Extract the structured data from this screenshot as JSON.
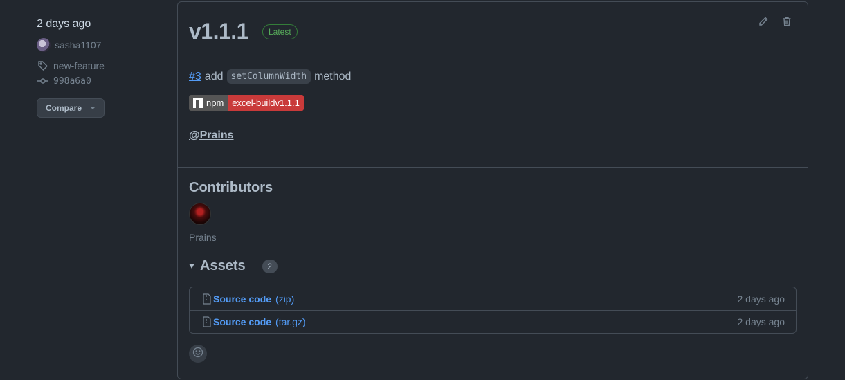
{
  "meta": {
    "date": "2 days ago",
    "author": "sasha1107",
    "tag": "new-feature",
    "commit": "998a6a0",
    "compare_label": "Compare"
  },
  "release": {
    "title": "v1.1.1",
    "latest_label": "Latest",
    "description": {
      "issue_link": "#3",
      "text_before": "add",
      "code": "setColumnWidth",
      "text_after": "method"
    },
    "npm_badge": {
      "left": "npm",
      "right": "excel-buildv1.1.1"
    },
    "mention": "@Prains"
  },
  "contributors": {
    "title": "Contributors",
    "items": [
      {
        "name": "Prains"
      }
    ]
  },
  "assets": {
    "title": "Assets",
    "count": "2",
    "items": [
      {
        "name": "Source code",
        "ext": "(zip)",
        "date": "2 days ago"
      },
      {
        "name": "Source code",
        "ext": "(tar.gz)",
        "date": "2 days ago"
      }
    ]
  },
  "icons": {
    "edit": "pencil-icon",
    "delete": "trash-icon",
    "tag": "tag-icon",
    "commit": "git-commit-icon",
    "file": "file-zip-icon",
    "reaction": "smiley-icon"
  },
  "colors": {
    "background": "#22272e",
    "link": "#539bf5",
    "latest": "#57ab5a",
    "npm_red": "#c93a3a"
  }
}
